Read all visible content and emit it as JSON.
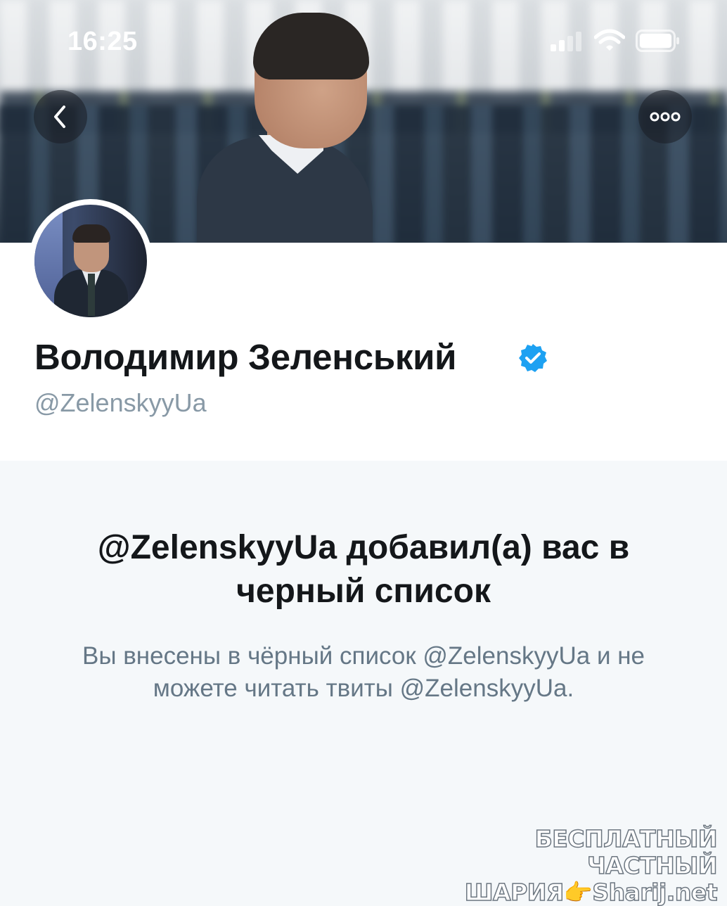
{
  "status_bar": {
    "time": "16:25"
  },
  "nav": {
    "back_icon": "chevron-left-icon",
    "more_icon": "more-horizontal-icon"
  },
  "profile": {
    "name": "Володимир Зеленський",
    "handle": "@ZelenskyyUa",
    "verified": true,
    "verified_color": "#1da1f2"
  },
  "blocked": {
    "title": "@ZelenskyyUa добавил(а) вас в черный список",
    "description": "Вы внесены в чёрный список @ZelenskyyUa и не можете читать твиты @ZelenskyyUa."
  },
  "watermark": {
    "line1": "БЕСПЛАТНЫЙ ЧАСТНЫЙ",
    "line2": "ШАРИЯ👉Sharij.net"
  }
}
